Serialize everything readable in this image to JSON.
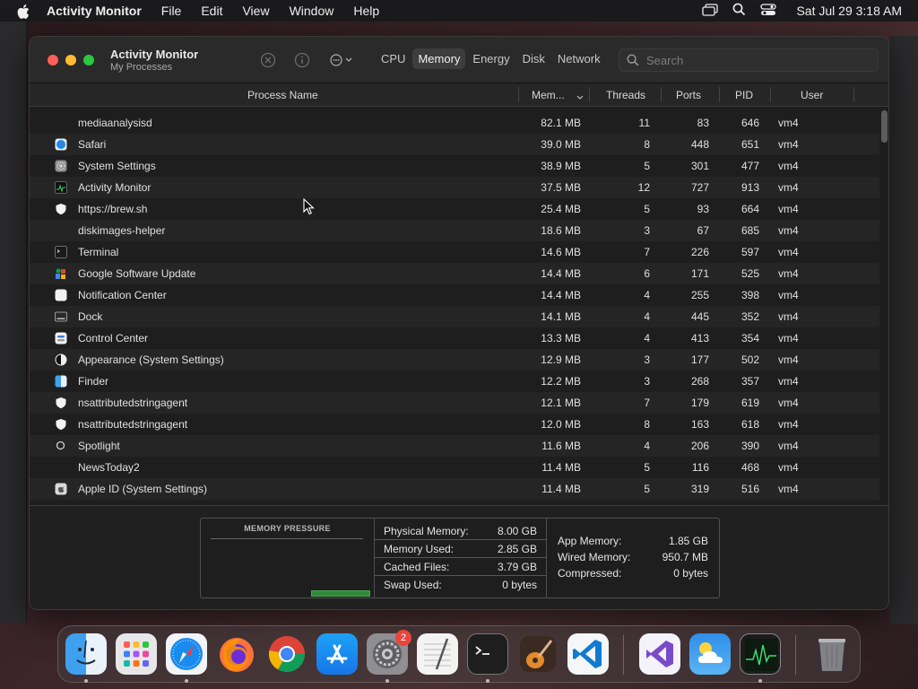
{
  "menubar": {
    "app_name": "Activity Monitor",
    "menus": [
      "File",
      "Edit",
      "View",
      "Window",
      "Help"
    ],
    "clock": "Sat Jul 29  3:18 AM"
  },
  "window": {
    "title": "Activity Monitor",
    "subtitle": "My Processes",
    "tabs": [
      "CPU",
      "Memory",
      "Energy",
      "Disk",
      "Network"
    ],
    "active_tab": "Memory",
    "search_placeholder": "Search"
  },
  "columns": {
    "name": "Process Name",
    "memory": "Mem...",
    "threads": "Threads",
    "ports": "Ports",
    "pid": "PID",
    "user": "User"
  },
  "processes": [
    {
      "name": "mediaanalysisd",
      "memory": "82.1 MB",
      "threads": "11",
      "ports": "83",
      "pid": "646",
      "user": "vm4",
      "icon": "none"
    },
    {
      "name": "Safari",
      "memory": "39.0 MB",
      "threads": "8",
      "ports": "448",
      "pid": "651",
      "user": "vm4",
      "icon": "safari-icon"
    },
    {
      "name": "System Settings",
      "memory": "38.9 MB",
      "threads": "5",
      "ports": "301",
      "pid": "477",
      "user": "vm4",
      "icon": "settings-gear-icon"
    },
    {
      "name": "Activity Monitor",
      "memory": "37.5 MB",
      "threads": "12",
      "ports": "727",
      "pid": "913",
      "user": "vm4",
      "icon": "activity-monitor-icon"
    },
    {
      "name": "https://brew.sh",
      "memory": "25.4 MB",
      "threads": "5",
      "ports": "93",
      "pid": "664",
      "user": "vm4",
      "icon": "shield-icon"
    },
    {
      "name": "diskimages-helper",
      "memory": "18.6 MB",
      "threads": "3",
      "ports": "67",
      "pid": "685",
      "user": "vm4",
      "icon": "none"
    },
    {
      "name": "Terminal",
      "memory": "14.6 MB",
      "threads": "7",
      "ports": "226",
      "pid": "597",
      "user": "vm4",
      "icon": "terminal-icon"
    },
    {
      "name": "Google Software Update",
      "memory": "14.4 MB",
      "threads": "6",
      "ports": "171",
      "pid": "525",
      "user": "vm4",
      "icon": "google-update-icon"
    },
    {
      "name": "Notification Center",
      "memory": "14.4 MB",
      "threads": "4",
      "ports": "255",
      "pid": "398",
      "user": "vm4",
      "icon": "notification-icon"
    },
    {
      "name": "Dock",
      "memory": "14.1 MB",
      "threads": "4",
      "ports": "445",
      "pid": "352",
      "user": "vm4",
      "icon": "dock-icon"
    },
    {
      "name": "Control Center",
      "memory": "13.3 MB",
      "threads": "4",
      "ports": "413",
      "pid": "354",
      "user": "vm4",
      "icon": "control-center-icon"
    },
    {
      "name": "Appearance (System Settings)",
      "memory": "12.9 MB",
      "threads": "3",
      "ports": "177",
      "pid": "502",
      "user": "vm4",
      "icon": "appearance-icon"
    },
    {
      "name": "Finder",
      "memory": "12.2 MB",
      "threads": "3",
      "ports": "268",
      "pid": "357",
      "user": "vm4",
      "icon": "finder-icon"
    },
    {
      "name": "nsattributedstringagent",
      "memory": "12.1 MB",
      "threads": "7",
      "ports": "179",
      "pid": "619",
      "user": "vm4",
      "icon": "shield-icon"
    },
    {
      "name": "nsattributedstringagent",
      "memory": "12.0 MB",
      "threads": "8",
      "ports": "163",
      "pid": "618",
      "user": "vm4",
      "icon": "shield-icon"
    },
    {
      "name": "Spotlight",
      "memory": "11.6 MB",
      "threads": "4",
      "ports": "206",
      "pid": "390",
      "user": "vm4",
      "icon": "spotlight-icon"
    },
    {
      "name": "NewsToday2",
      "memory": "11.4 MB",
      "threads": "5",
      "ports": "116",
      "pid": "468",
      "user": "vm4",
      "icon": "none"
    },
    {
      "name": "Apple ID (System Settings)",
      "memory": "11.4 MB",
      "threads": "5",
      "ports": "319",
      "pid": "516",
      "user": "vm4",
      "icon": "apple-id-icon"
    }
  ],
  "memory_panel": {
    "pressure_label": "MEMORY PRESSURE",
    "physical_label": "Physical Memory:",
    "physical_value": "8.00 GB",
    "used_label": "Memory Used:",
    "used_value": "2.85 GB",
    "cached_label": "Cached Files:",
    "cached_value": "3.79 GB",
    "swap_label": "Swap Used:",
    "swap_value": "0 bytes",
    "app_label": "App Memory:",
    "app_value": "1.85 GB",
    "wired_label": "Wired Memory:",
    "wired_value": "950.7 MB",
    "compressed_label": "Compressed:",
    "compressed_value": "0 bytes"
  },
  "dock": {
    "items": [
      "finder-icon",
      "launchpad-icon",
      "safari-icon",
      "firefox-icon",
      "chrome-icon",
      "app-store-icon",
      "system-settings-icon",
      "textedit-icon",
      "terminal-icon",
      "garageband-icon",
      "vscode-icon",
      "visual-studio-icon",
      "weather-icon",
      "activity-monitor-icon",
      "trash-icon"
    ],
    "settings_badge": "2"
  }
}
